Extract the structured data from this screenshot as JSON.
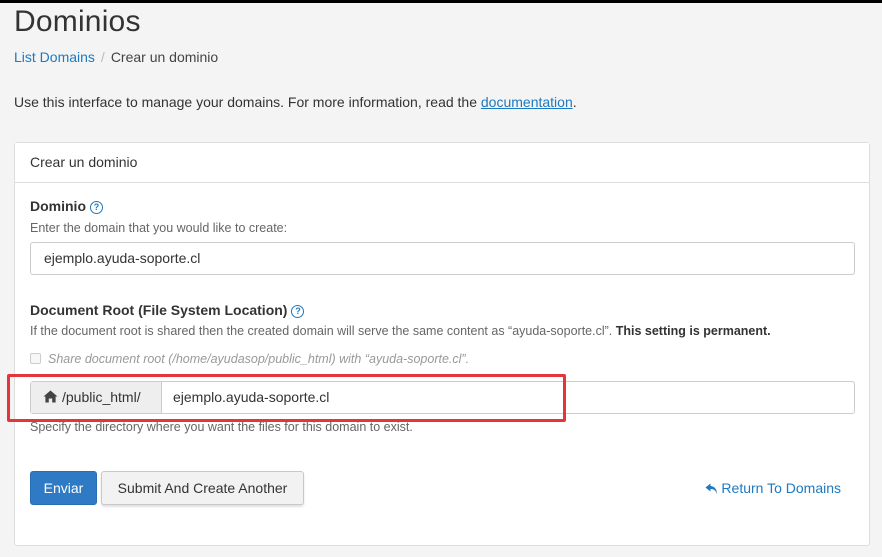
{
  "page": {
    "title": "Dominios",
    "intro_text": "Use this interface to manage your domains. For more information, read the ",
    "intro_link": "documentation",
    "intro_end": "."
  },
  "breadcrumb": {
    "parent": "List Domains",
    "separator": "/",
    "current": "Crear un dominio"
  },
  "panel": {
    "heading": "Crear un dominio",
    "domain": {
      "label": "Dominio",
      "help": "?",
      "hint": "Enter the domain that you would like to create:",
      "value": "ejemplo.ayuda-soporte.cl"
    },
    "docroot": {
      "label": "Document Root (File System Location)",
      "help": "?",
      "hint_start": "If the document root is shared then the created domain will serve the same content as “ayuda-soporte.cl”. ",
      "hint_bold": "This setting is permanent.",
      "share_checkbox_label": "Share document root (/home/ayudasop/public_html) with “ayuda-soporte.cl”.",
      "share_checked": false,
      "prefix": "/public_html/",
      "prefix_icon": "home-icon",
      "value": "ejemplo.ayuda-soporte.cl",
      "footer_hint": "Specify the directory where you want the files for this domain to exist."
    },
    "actions": {
      "submit": "Enviar",
      "submit_another": "Submit And Create Another",
      "return": "Return To Domains",
      "return_icon": "reply-arrow-icon"
    }
  },
  "colors": {
    "link": "#1d79c0",
    "primary_button": "#2f7ac4",
    "highlight_box": "#e3353a"
  }
}
